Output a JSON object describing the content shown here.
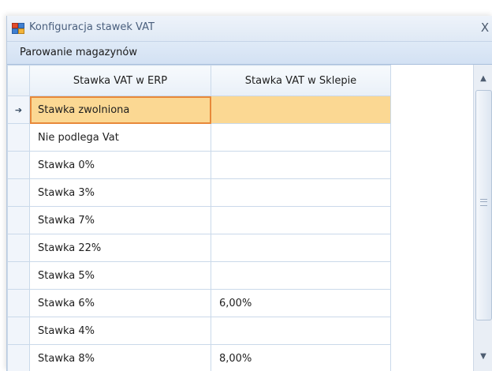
{
  "window": {
    "title": "Konfiguracja stawek VAT",
    "close_label": "X"
  },
  "menu": {
    "items": [
      {
        "label": "Parowanie magazynów"
      }
    ]
  },
  "grid": {
    "columns": [
      {
        "label": "Stawka VAT w ERP"
      },
      {
        "label": "Stawka VAT w Sklepie"
      }
    ],
    "selected_row": 0,
    "rows": [
      {
        "erp": "Stawka zwolniona",
        "shop": ""
      },
      {
        "erp": "Nie podlega Vat",
        "shop": ""
      },
      {
        "erp": "Stawka 0%",
        "shop": ""
      },
      {
        "erp": "Stawka 3%",
        "shop": ""
      },
      {
        "erp": "Stawka 7%",
        "shop": ""
      },
      {
        "erp": "Stawka 22%",
        "shop": ""
      },
      {
        "erp": "Stawka 5%",
        "shop": ""
      },
      {
        "erp": "Stawka 6%",
        "shop": "6,00%"
      },
      {
        "erp": "Stawka 4%",
        "shop": ""
      },
      {
        "erp": "Stawka 8%",
        "shop": "8,00%"
      }
    ]
  },
  "icons": {
    "row_indicator": "current-row-arrow-icon",
    "app": "grid-table-icon"
  },
  "colors": {
    "selected_row": "#fbd893",
    "active_cell_border": "#e8893a",
    "menubar": "#d3e1f3"
  }
}
